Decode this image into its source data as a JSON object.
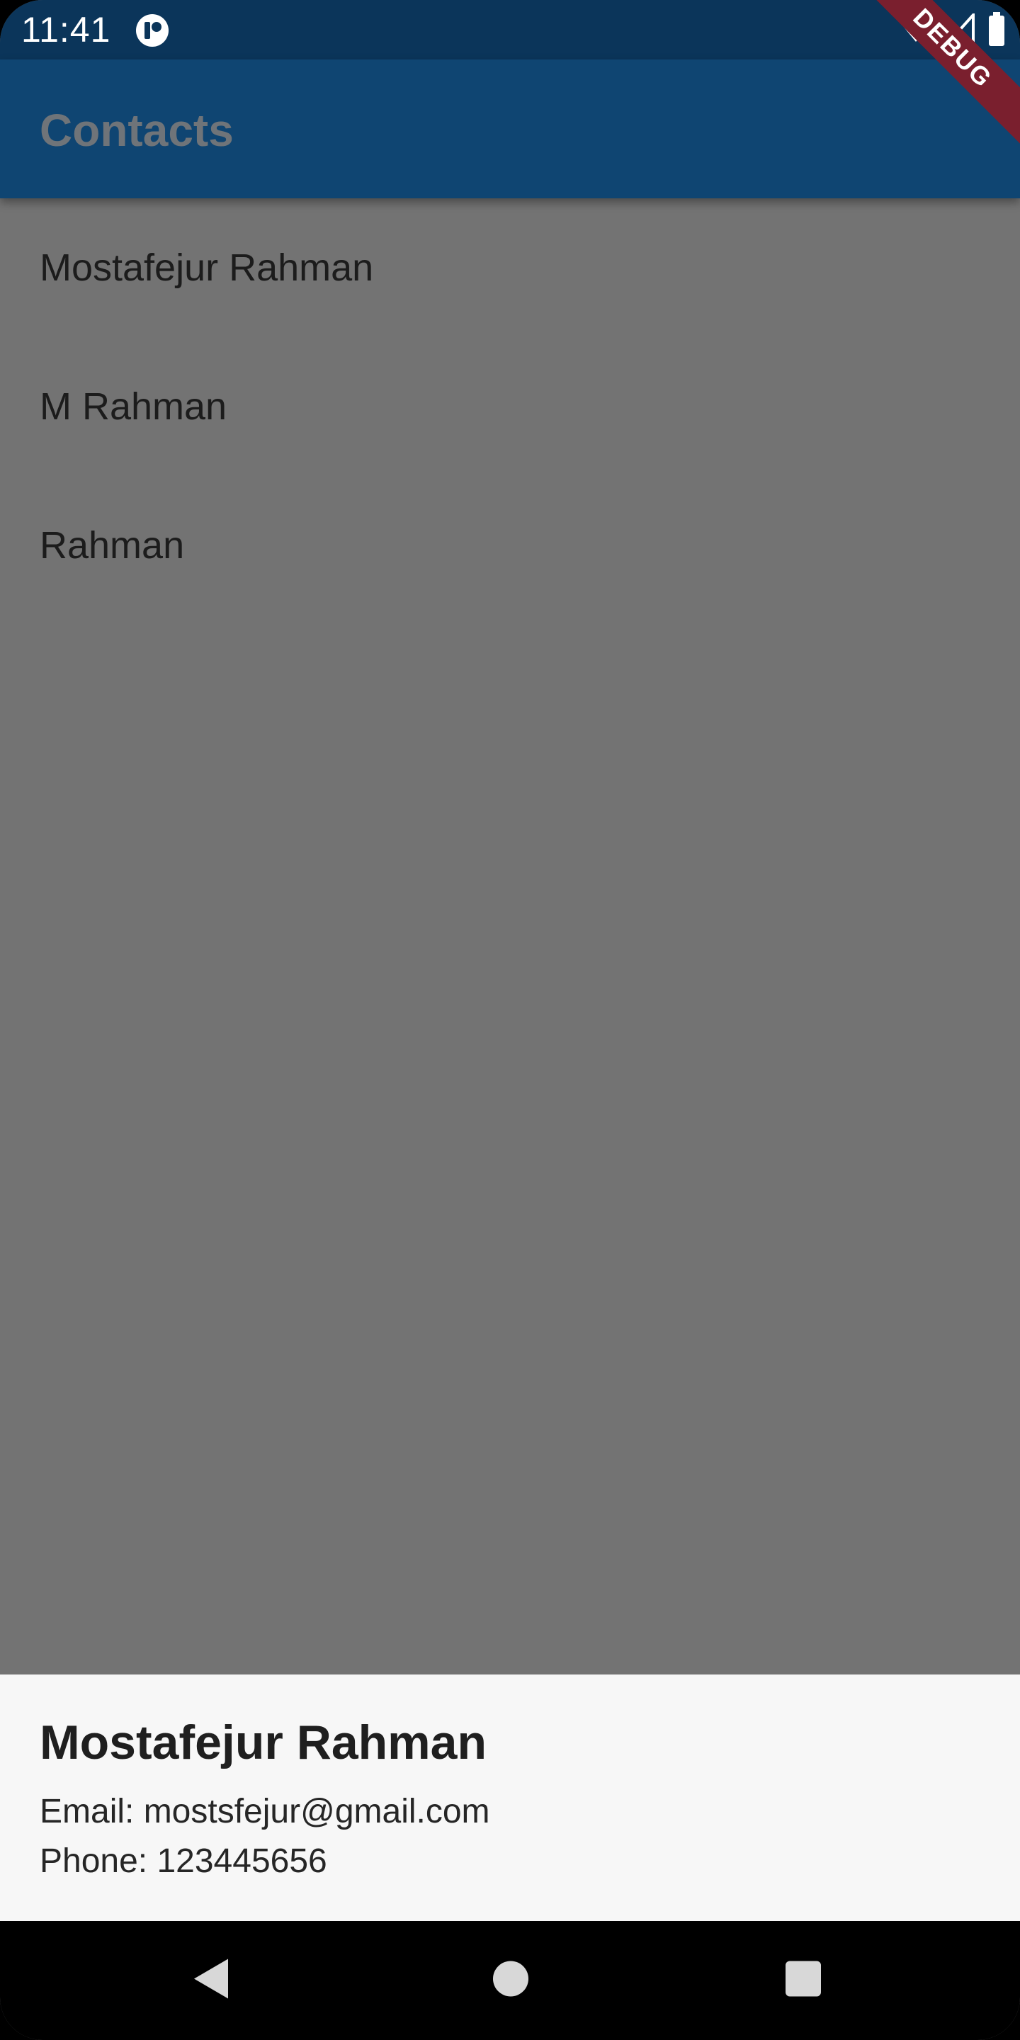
{
  "status_bar": {
    "time": "11:41",
    "app_icon": "notification-app-icon",
    "icons": [
      "wifi-icon",
      "signal-icon",
      "battery-icon"
    ]
  },
  "debug_banner": "DEBUG",
  "app_bar": {
    "title": "Contacts"
  },
  "contacts": [
    {
      "name": "Mostafejur Rahman"
    },
    {
      "name": "M Rahman"
    },
    {
      "name": "Rahman"
    }
  ],
  "bottom_sheet": {
    "name": "Mostafejur Rahman",
    "email": "Email: mostsfejur@gmail.com",
    "phone": "Phone: 123445656"
  },
  "nav_bar": {
    "icons": [
      "back-icon",
      "home-icon",
      "recents-icon"
    ]
  },
  "colors": {
    "status_bar": "#0b355a",
    "app_bar": "#0f4572",
    "scrim": "#737373",
    "sheet": "#f7f7f7",
    "debug": "#7a1f2e"
  }
}
